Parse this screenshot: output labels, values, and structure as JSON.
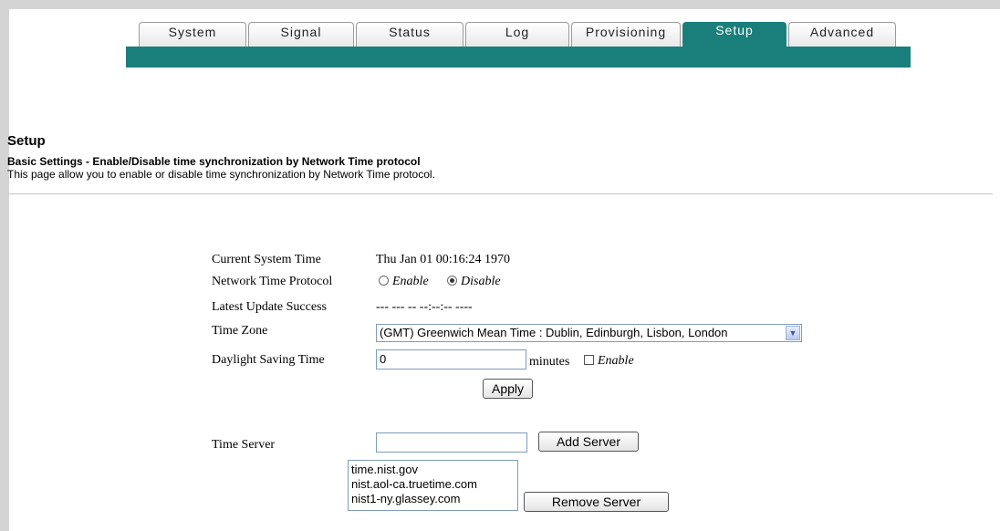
{
  "tabs": [
    {
      "label": "System",
      "active": false
    },
    {
      "label": "Signal",
      "active": false
    },
    {
      "label": "Status",
      "active": false
    },
    {
      "label": "Log",
      "active": false
    },
    {
      "label": "Provisioning",
      "active": false
    },
    {
      "label": "Setup",
      "active": true
    },
    {
      "label": "Advanced",
      "active": false
    }
  ],
  "colors": {
    "accent": "#1a7f7a"
  },
  "page": {
    "title": "Setup",
    "subtitle": "Basic Settings - Enable/Disable time synchronization by Network Time protocol",
    "description": "This page allow you to enable or disable time synchronization by Network Time protocol."
  },
  "form": {
    "current_time_label": "Current System Time",
    "current_time_value": "Thu Jan 01 00:16:24 1970",
    "ntp_label": "Network Time Protocol",
    "ntp_enable": "Enable",
    "ntp_disable": "Disable",
    "ntp_selected": "Disable",
    "latest_update_label": "Latest Update Success",
    "latest_update_value": "--- --- -- --:--:-- ----",
    "time_zone_label": "Time Zone",
    "time_zone_value": "(GMT) Greenwich Mean Time : Dublin, Edinburgh, Lisbon, London",
    "dst_label": "Daylight Saving Time",
    "dst_value": "0",
    "dst_unit": "minutes",
    "dst_enable": "Enable",
    "apply_label": "Apply",
    "time_server_label": "Time Server",
    "time_server_value": "",
    "add_server_label": "Add Server",
    "servers": [
      "time.nist.gov",
      "nist.aol-ca.truetime.com",
      "nist1-ny.glassey.com"
    ],
    "remove_server_label": "Remove Server"
  }
}
